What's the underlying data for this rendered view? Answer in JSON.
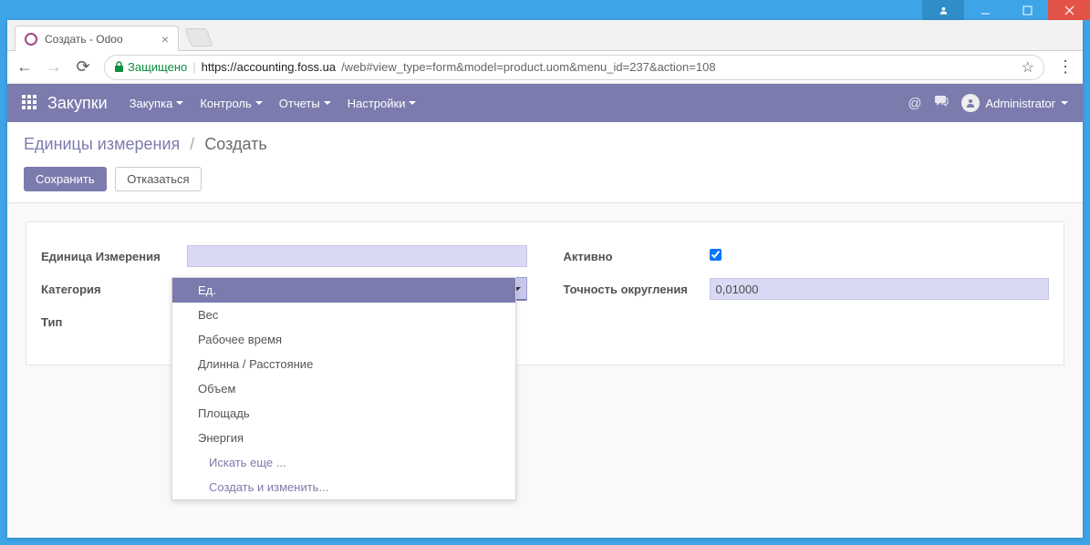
{
  "window": {
    "tab_title": "Создать - Odoo"
  },
  "browser": {
    "secure_label": "Защищено",
    "url_host": "https://accounting.foss.ua",
    "url_path": "/web#view_type=form&model=product.uom&menu_id=237&action=108"
  },
  "topbar": {
    "app_name": "Закупки",
    "menu": [
      "Закупка",
      "Контроль",
      "Отчеты",
      "Настройки"
    ],
    "user_name": "Administrator"
  },
  "breadcrumb": {
    "parent": "Единицы измерения",
    "current": "Создать"
  },
  "buttons": {
    "save": "Сохранить",
    "discard": "Отказаться"
  },
  "form": {
    "left": {
      "uom_label": "Единица Измерения",
      "uom_value": "",
      "category_label": "Категория",
      "category_value": "",
      "type_label": "Тип"
    },
    "right": {
      "active_label": "Активно",
      "active_value": true,
      "rounding_label": "Точность округления",
      "rounding_value": "0,01000"
    }
  },
  "dropdown": {
    "options": [
      "Ед.",
      "Вес",
      "Рабочее время",
      "Длинна / Расстояние",
      "Объем",
      "Площадь",
      "Энергия"
    ],
    "search_more": "Искать еще ...",
    "create_edit": "Создать и изменить..."
  }
}
